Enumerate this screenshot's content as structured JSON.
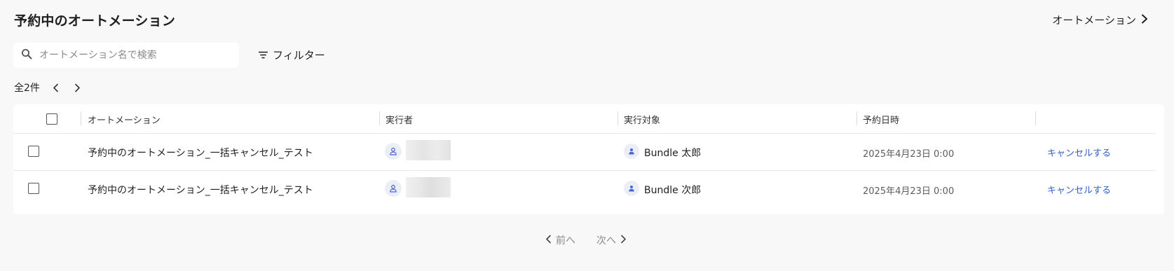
{
  "header": {
    "title": "予約中のオートメーション",
    "automation_link": "オートメーション"
  },
  "search": {
    "placeholder": "オートメーション名で検索",
    "value": ""
  },
  "filter_label": "フィルター",
  "count_label": "全2件",
  "table": {
    "columns": [
      "オートメーション",
      "実行者",
      "実行対象",
      "予約日時"
    ],
    "rows": [
      {
        "automation": "予約中のオートメーション_一括キャンセル_テスト",
        "target": "Bundle 太郎",
        "datetime": "2025年4月23日 0:00",
        "action": "キャンセルする"
      },
      {
        "automation": "予約中のオートメーション_一括キャンセル_テスト",
        "target": "Bundle 次郎",
        "datetime": "2025年4月23日 0:00",
        "action": "キャンセルする"
      }
    ]
  },
  "pagination": {
    "prev": "前へ",
    "next": "次へ"
  },
  "colors": {
    "link": "#2f5fd0",
    "avatar_icon": "#4a66d6",
    "background": "#f8f8f8"
  },
  "icons": [
    "chevron-right-icon",
    "search-icon",
    "filter-icon",
    "chevron-left-icon",
    "user-outline-icon",
    "user-filled-icon"
  ]
}
